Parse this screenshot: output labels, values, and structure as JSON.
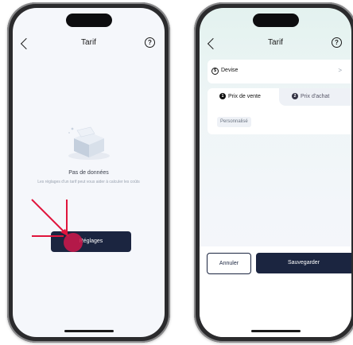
{
  "left_screen": {
    "header": {
      "title": "Tarif",
      "help_icon": "?"
    },
    "empty_state": {
      "title": "Pas de données",
      "description": "Les réglages d'un tarif peut vous aider à calculer les coûts"
    },
    "primary_button": "Réglages",
    "annotation_color": "#e0143c"
  },
  "right_screen": {
    "header": {
      "title": "Tarif",
      "help_icon": "?"
    },
    "devise": {
      "label": "Devise",
      "chevron": ">"
    },
    "tabs": [
      {
        "number": "1",
        "label": "Prix de vente"
      },
      {
        "number": "2",
        "label": "Prix d'achat"
      }
    ],
    "chip": "Personnalisé",
    "buttons": {
      "cancel": "Annuler",
      "save": "Sauvegarder"
    }
  },
  "colors": {
    "primary": "#1b2540",
    "background": "#f5f7fb",
    "tap": "#c9184a"
  }
}
